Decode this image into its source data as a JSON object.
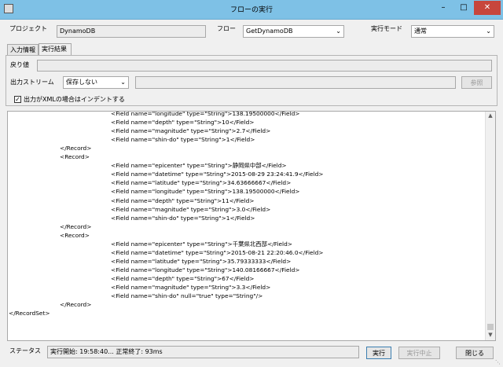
{
  "window": {
    "title": "フローの実行",
    "minimize_glyph": "–",
    "maximize_glyph": "□",
    "close_glyph": "✕"
  },
  "form": {
    "project_label": "プロジェクト",
    "project_value": "DynamoDB",
    "flow_label": "フロー",
    "flow_value": "GetDynamoDB",
    "mode_label": "実行モード",
    "mode_value": "通常"
  },
  "tabs": [
    {
      "label": "入力情報",
      "active": false
    },
    {
      "label": "実行結果",
      "active": true
    }
  ],
  "result_panel": {
    "return_label": "戻り値",
    "return_value": "",
    "stream_label": "出力ストリーム",
    "stream_value": "保存しない",
    "stream_path": "",
    "browse_label": "参照",
    "indent_label": "出力がXMLの場合はインデントする",
    "indent_checked": true
  },
  "output_lines": [
    {
      "indent": 2,
      "text": "<Field name=\"longitude\" type=\"String\">138.19500000</Field>"
    },
    {
      "indent": 2,
      "text": "<Field name=\"depth\" type=\"String\">10</Field>"
    },
    {
      "indent": 2,
      "text": "<Field name=\"magnitude\" type=\"String\">2.7</Field>"
    },
    {
      "indent": 2,
      "text": "<Field name=\"shin-do\" type=\"String\">1</Field>"
    },
    {
      "indent": 1,
      "text": "</Record>"
    },
    {
      "indent": 1,
      "text": "<Record>"
    },
    {
      "indent": 2,
      "text": "<Field name=\"epicenter\" type=\"String\">静岡県中部</Field>"
    },
    {
      "indent": 2,
      "text": "<Field name=\"datetime\" type=\"String\">2015-08-29 23:24:41.9</Field>"
    },
    {
      "indent": 2,
      "text": "<Field name=\"latitude\" type=\"String\">34.63666667</Field>"
    },
    {
      "indent": 2,
      "text": "<Field name=\"longitude\" type=\"String\">138.19500000</Field>"
    },
    {
      "indent": 2,
      "text": "<Field name=\"depth\" type=\"String\">11</Field>"
    },
    {
      "indent": 2,
      "text": "<Field name=\"magnitude\" type=\"String\">3.0</Field>"
    },
    {
      "indent": 2,
      "text": "<Field name=\"shin-do\" type=\"String\">1</Field>"
    },
    {
      "indent": 1,
      "text": "</Record>"
    },
    {
      "indent": 1,
      "text": "<Record>"
    },
    {
      "indent": 2,
      "text": "<Field name=\"epicenter\" type=\"String\">千葉県北西部</Field>"
    },
    {
      "indent": 2,
      "text": "<Field name=\"datetime\" type=\"String\">2015-08-21 22:20:46.0</Field>"
    },
    {
      "indent": 2,
      "text": "<Field name=\"latitude\" type=\"String\">35.79333333</Field>"
    },
    {
      "indent": 2,
      "text": "<Field name=\"longitude\" type=\"String\">140.08166667</Field>"
    },
    {
      "indent": 2,
      "text": "<Field name=\"depth\" type=\"String\">67</Field>"
    },
    {
      "indent": 2,
      "text": "<Field name=\"magnitude\" type=\"String\">3.3</Field>"
    },
    {
      "indent": 2,
      "text": "<Field name=\"shin-do\" null=\"true\" type=\"String\"/>"
    },
    {
      "indent": 1,
      "text": "</Record>"
    },
    {
      "indent": 0,
      "text": "</RecordSet>"
    }
  ],
  "status": {
    "label": "ステータス",
    "value": "実行開始: 19:58:40... 正常終了: 93ms"
  },
  "buttons": {
    "run": "実行",
    "stop": "実行中止",
    "close": "閉じる"
  },
  "icons": {
    "dropdown": "chevron-down-icon",
    "scroll_up": "arrow-up-icon",
    "scroll_down": "arrow-down-icon",
    "check": "checkmark-icon"
  }
}
